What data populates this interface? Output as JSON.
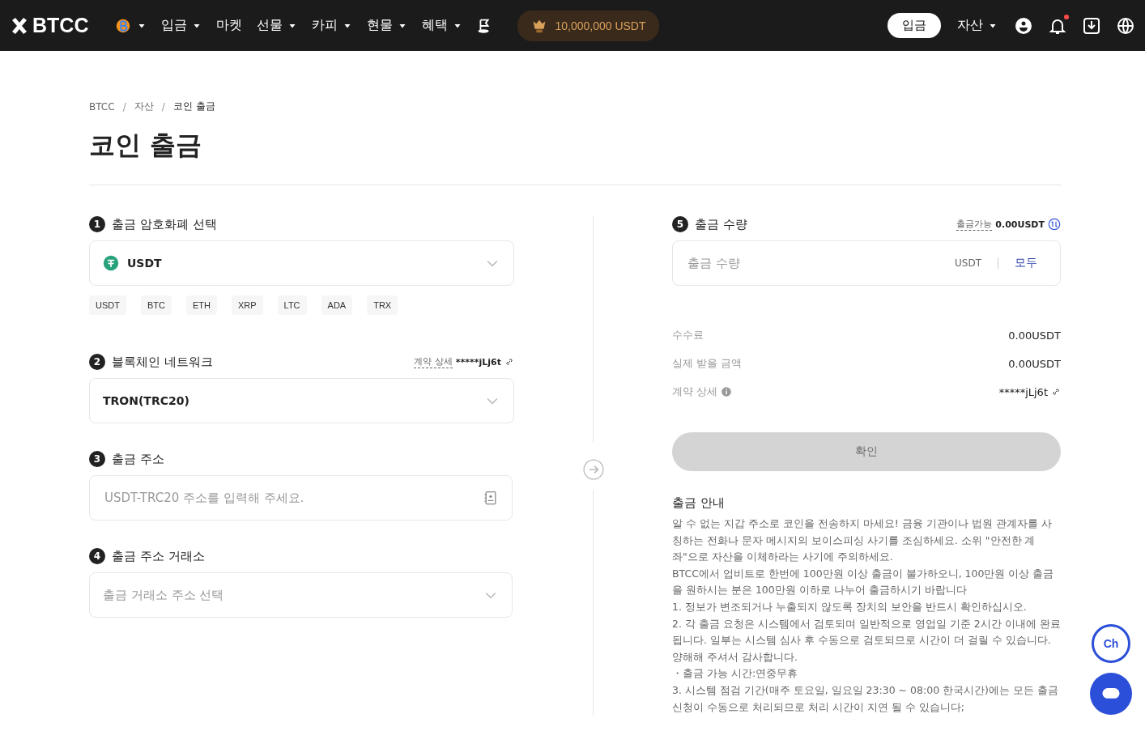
{
  "nav": {
    "logo": "BTCC",
    "menu": [
      {
        "kind": "coin-icon"
      },
      {
        "kind": "dropdown",
        "label": "입금"
      },
      {
        "kind": "link",
        "label": "마켓"
      },
      {
        "kind": "dropdown",
        "label": "선물"
      },
      {
        "kind": "dropdown",
        "label": "카피"
      },
      {
        "kind": "dropdown",
        "label": "현물"
      },
      {
        "kind": "dropdown",
        "label": "혜택"
      },
      {
        "kind": "flag-icon"
      }
    ],
    "promo": "10,000,000 USDT",
    "deposit_button": "입금",
    "assets_menu": "자산",
    "notification_dot": true
  },
  "breadcrumb": {
    "items": [
      "BTCC",
      "자산",
      "코인 출금"
    ],
    "separator": "/"
  },
  "page_title": "코인 출금",
  "steps": {
    "coin": {
      "number": "1",
      "title": "출금 암호화폐 선택",
      "value": "USDT",
      "chips": [
        "USDT",
        "BTC",
        "ETH",
        "XRP",
        "LTC",
        "ADA",
        "TRX"
      ]
    },
    "network": {
      "number": "2",
      "title": "블록체인 네트워크",
      "contract_label": "계약 상세",
      "contract_value": "*****jLj6t",
      "value": "TRON(TRC20)"
    },
    "address": {
      "number": "3",
      "title": "출금 주소",
      "placeholder": "USDT-TRC20 주소를 입력해 주세요."
    },
    "exchange": {
      "number": "4",
      "title": "출금 주소 거래소",
      "placeholder": "출금 거래소 주소 선택"
    },
    "amount": {
      "number": "5",
      "title": "출금 수량",
      "available_label": "출금가능",
      "available_value": "0.00USDT",
      "placeholder": "출금 수량",
      "unit": "USDT",
      "all_button": "모두"
    }
  },
  "summary": [
    {
      "label": "수수료",
      "value": "0.00USDT",
      "kind": "plain"
    },
    {
      "label": "실제 받을 금액",
      "value": "0.00USDT",
      "kind": "plain"
    },
    {
      "label": "계약 상세",
      "value": "*****jLj6t",
      "kind": "contract"
    }
  ],
  "confirm": {
    "label": "확인",
    "disabled": true
  },
  "guide": {
    "title": "출금 안내",
    "paragraphs": [
      "알 수 없는 지갑 주소로 코인을 전송하지 마세요! 금융 기관이나 법원 관계자를 사칭하는 전화나 문자 메시지의 보이스피싱 사기를 조심하세요. 소위 \"안전한 계좌\"으로 자산을 이체하라는 사기에 주의하세요.",
      "BTCC에서 업비트로 한번에 100만원 이상 출금이 불가하오니, 100만원 이상 출금을 원하시는 분은 100만원 이하로 나누어 출금하시기 바랍니다",
      "1. 정보가 변조되거나 누출되지 않도록 장치의 보안을 반드시 확인하십시오.",
      "2. 각 출금 요청은 시스템에서 검토되며 일반적으로 영업일 기준 2시간 이내에 완료됩니다. 일부는 시스템 심사 후 수동으로 검토되므로 시간이 더 걸릴 수 있습니다. 양해해 주셔서 감사합니다.",
      "・출금 가능 시간:연중무휴",
      "3. 시스템 점검 기간(매주 토요일, 일요일 23:30 ~ 08:00 한국시간)에는 모든 출금 신청이 수동으로 처리되므로 처리 시간이 지연 될 수 있습니다;"
    ]
  },
  "chat_badge": "Ch"
}
